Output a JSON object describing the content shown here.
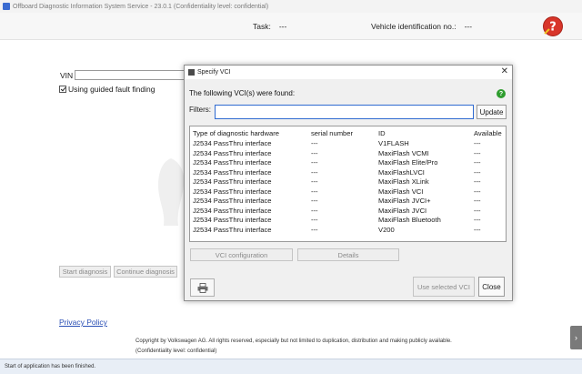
{
  "window": {
    "title": "Offboard Diagnostic Information System Service - 23.0.1 (Confidentiality level: confidential)"
  },
  "header": {
    "task_label": "Task:",
    "task_value": "---",
    "vin_label": "Vehicle identification no.:",
    "vin_value": "---",
    "help_icon": "help-question-icon"
  },
  "main": {
    "vin_label": "VIN",
    "vin_value": "",
    "guided_label": "Using guided fault finding",
    "guided_checked": true,
    "start_label": "Start diagnosis",
    "continue_label": "Continue diagnosis",
    "privacy_label": "Privacy Policy",
    "copyright_line1": "Copyright by Volkswagen AG. All rights reserved, especially but not limited to duplication, distribution and making publicly available.",
    "copyright_line2": "(Confidentiality level: confidential)"
  },
  "status": {
    "text": "Start of application has been finished."
  },
  "dialog": {
    "title": "Specify VCI",
    "found_label": "The following VCI(s) were found:",
    "filters_label": "Filters:",
    "filters_value": "",
    "update_label": "Update",
    "columns": [
      "Type of diagnostic hardware",
      "serial number",
      "ID",
      "Available"
    ],
    "rows": [
      [
        "J2534 PassThru interface",
        "---",
        "V1FLASH",
        "---"
      ],
      [
        "J2534 PassThru interface",
        "---",
        "MaxiFlash VCMI",
        "---"
      ],
      [
        "J2534 PassThru interface",
        "---",
        "MaxiFlash Elite/Pro",
        "---"
      ],
      [
        "J2534 PassThru interface",
        "---",
        "MaxiFlashLVCI",
        "---"
      ],
      [
        "J2534 PassThru interface",
        "---",
        "MaxiFlash XLink",
        "---"
      ],
      [
        "J2534 PassThru interface",
        "---",
        "MaxiFlash VCI",
        "---"
      ],
      [
        "J2534 PassThru interface",
        "---",
        "MaxiFlash JVCI+",
        "---"
      ],
      [
        "J2534 PassThru interface",
        "---",
        "MaxiFlash JVCI",
        "---"
      ],
      [
        "J2534 PassThru interface",
        "---",
        "MaxiFlash Bluetooth",
        "---"
      ],
      [
        "J2534 PassThru interface",
        "---",
        "V200",
        "---"
      ]
    ],
    "vci_config_label": "VCI configuration",
    "details_label": "Details",
    "use_selected_label": "Use selected VCI",
    "close_label": "Close",
    "close_x": "✕"
  },
  "colors": {
    "accent": "#2f6ad0",
    "help_green": "#2e9d2e",
    "help_red": "#d8352a",
    "link": "#2a4fb5"
  }
}
